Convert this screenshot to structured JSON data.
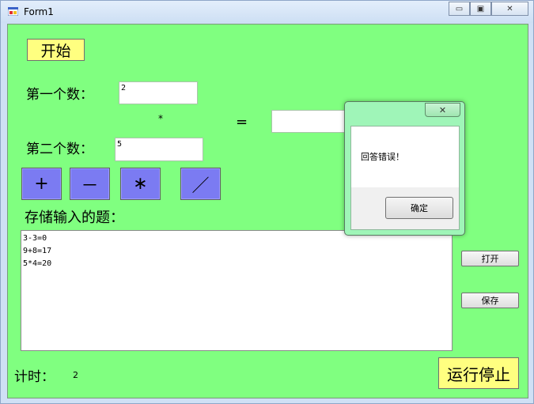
{
  "window": {
    "title": "Form1",
    "minimize": "▭",
    "maximize": "▣",
    "close": "✕"
  },
  "form": {
    "start_button": "开始",
    "first_label": "第一个数：",
    "first_value": "2",
    "operator": "*",
    "equals": "=",
    "answer_value": "",
    "second_label": "第二个数：",
    "second_value": "5",
    "ops": [
      "+",
      "－",
      "∗",
      "／"
    ],
    "store_label": "存储输入的题：",
    "stored": [
      "3-3=0",
      "9+8=17",
      "5*4=20"
    ],
    "open_button": "打开",
    "save_button": "保存",
    "timer_label": "计时：",
    "timer_value": "2",
    "stop_button": "运行停止"
  },
  "dialog": {
    "message": "回答错误！",
    "ok_button": "确定",
    "close": "✕"
  },
  "colors": {
    "form_bg": "#80ff80",
    "yellow_button": "#ffff80",
    "op_button": "#7b7bf2"
  }
}
